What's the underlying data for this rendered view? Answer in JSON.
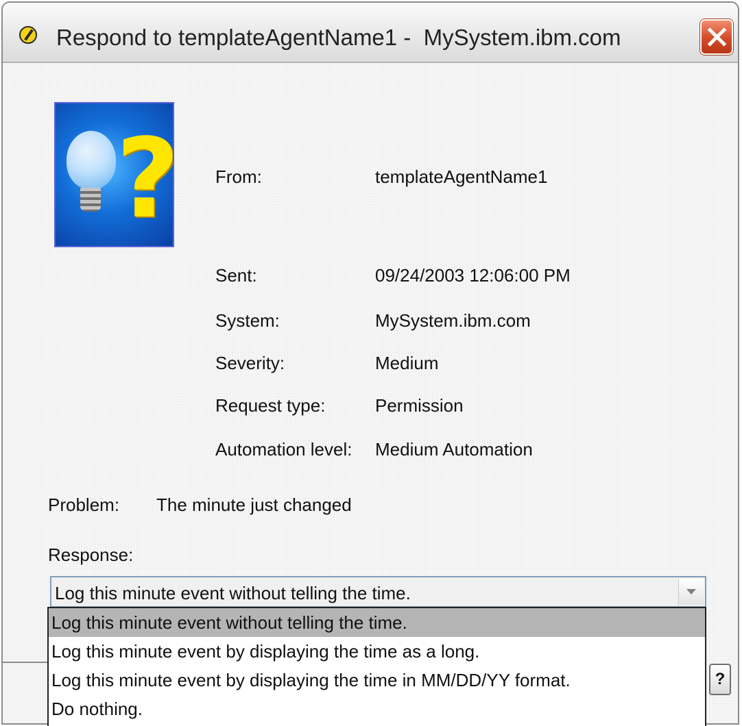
{
  "window": {
    "title": "Respond to templateAgentName1 -  MySystem.ibm.com"
  },
  "details": {
    "from_label": "From:",
    "from_value": "templateAgentName1",
    "sent_label": "Sent:",
    "sent_value": "09/24/2003 12:06:00 PM",
    "system_label": "System:",
    "system_value": "MySystem.ibm.com",
    "severity_label": "Severity:",
    "severity_value": "Medium",
    "request_type_label": "Request type:",
    "request_type_value": "Permission",
    "automation_label": "Automation level:",
    "automation_value": "Medium Automation"
  },
  "problem": {
    "label": "Problem:",
    "value": "The minute just changed"
  },
  "response": {
    "label": "Response:",
    "selected": "Log this minute event without telling the time.",
    "options": [
      "Log this minute event without telling the time.",
      "Log this minute event by displaying the time as a long.",
      "Log this minute event by displaying the time in MM/DD/YY format.",
      "Do nothing."
    ]
  },
  "help_button": "?",
  "colors": {
    "selection": "#b5b5b5",
    "close_button": "#d24b27",
    "combo_border": "#7f9db9"
  }
}
